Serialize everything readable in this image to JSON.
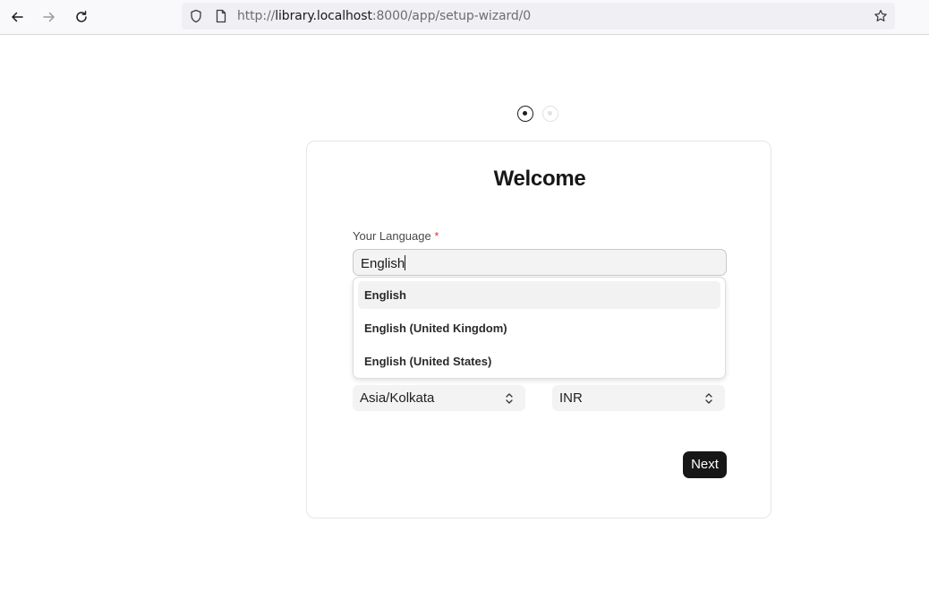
{
  "browser": {
    "url_prefix": "http://",
    "url_host": "library.localhost",
    "url_rest": ":8000/app/setup-wizard/0"
  },
  "wizard": {
    "title": "Welcome",
    "language_label": "Your Language",
    "required_mark": "*",
    "language_value": "English",
    "language_options": [
      "English",
      "English (United Kingdom)",
      "English (United States)"
    ],
    "timezone_value": "Asia/Kolkata",
    "currency_value": "INR",
    "next_label": "Next",
    "current_step": 1,
    "total_steps": 2
  }
}
